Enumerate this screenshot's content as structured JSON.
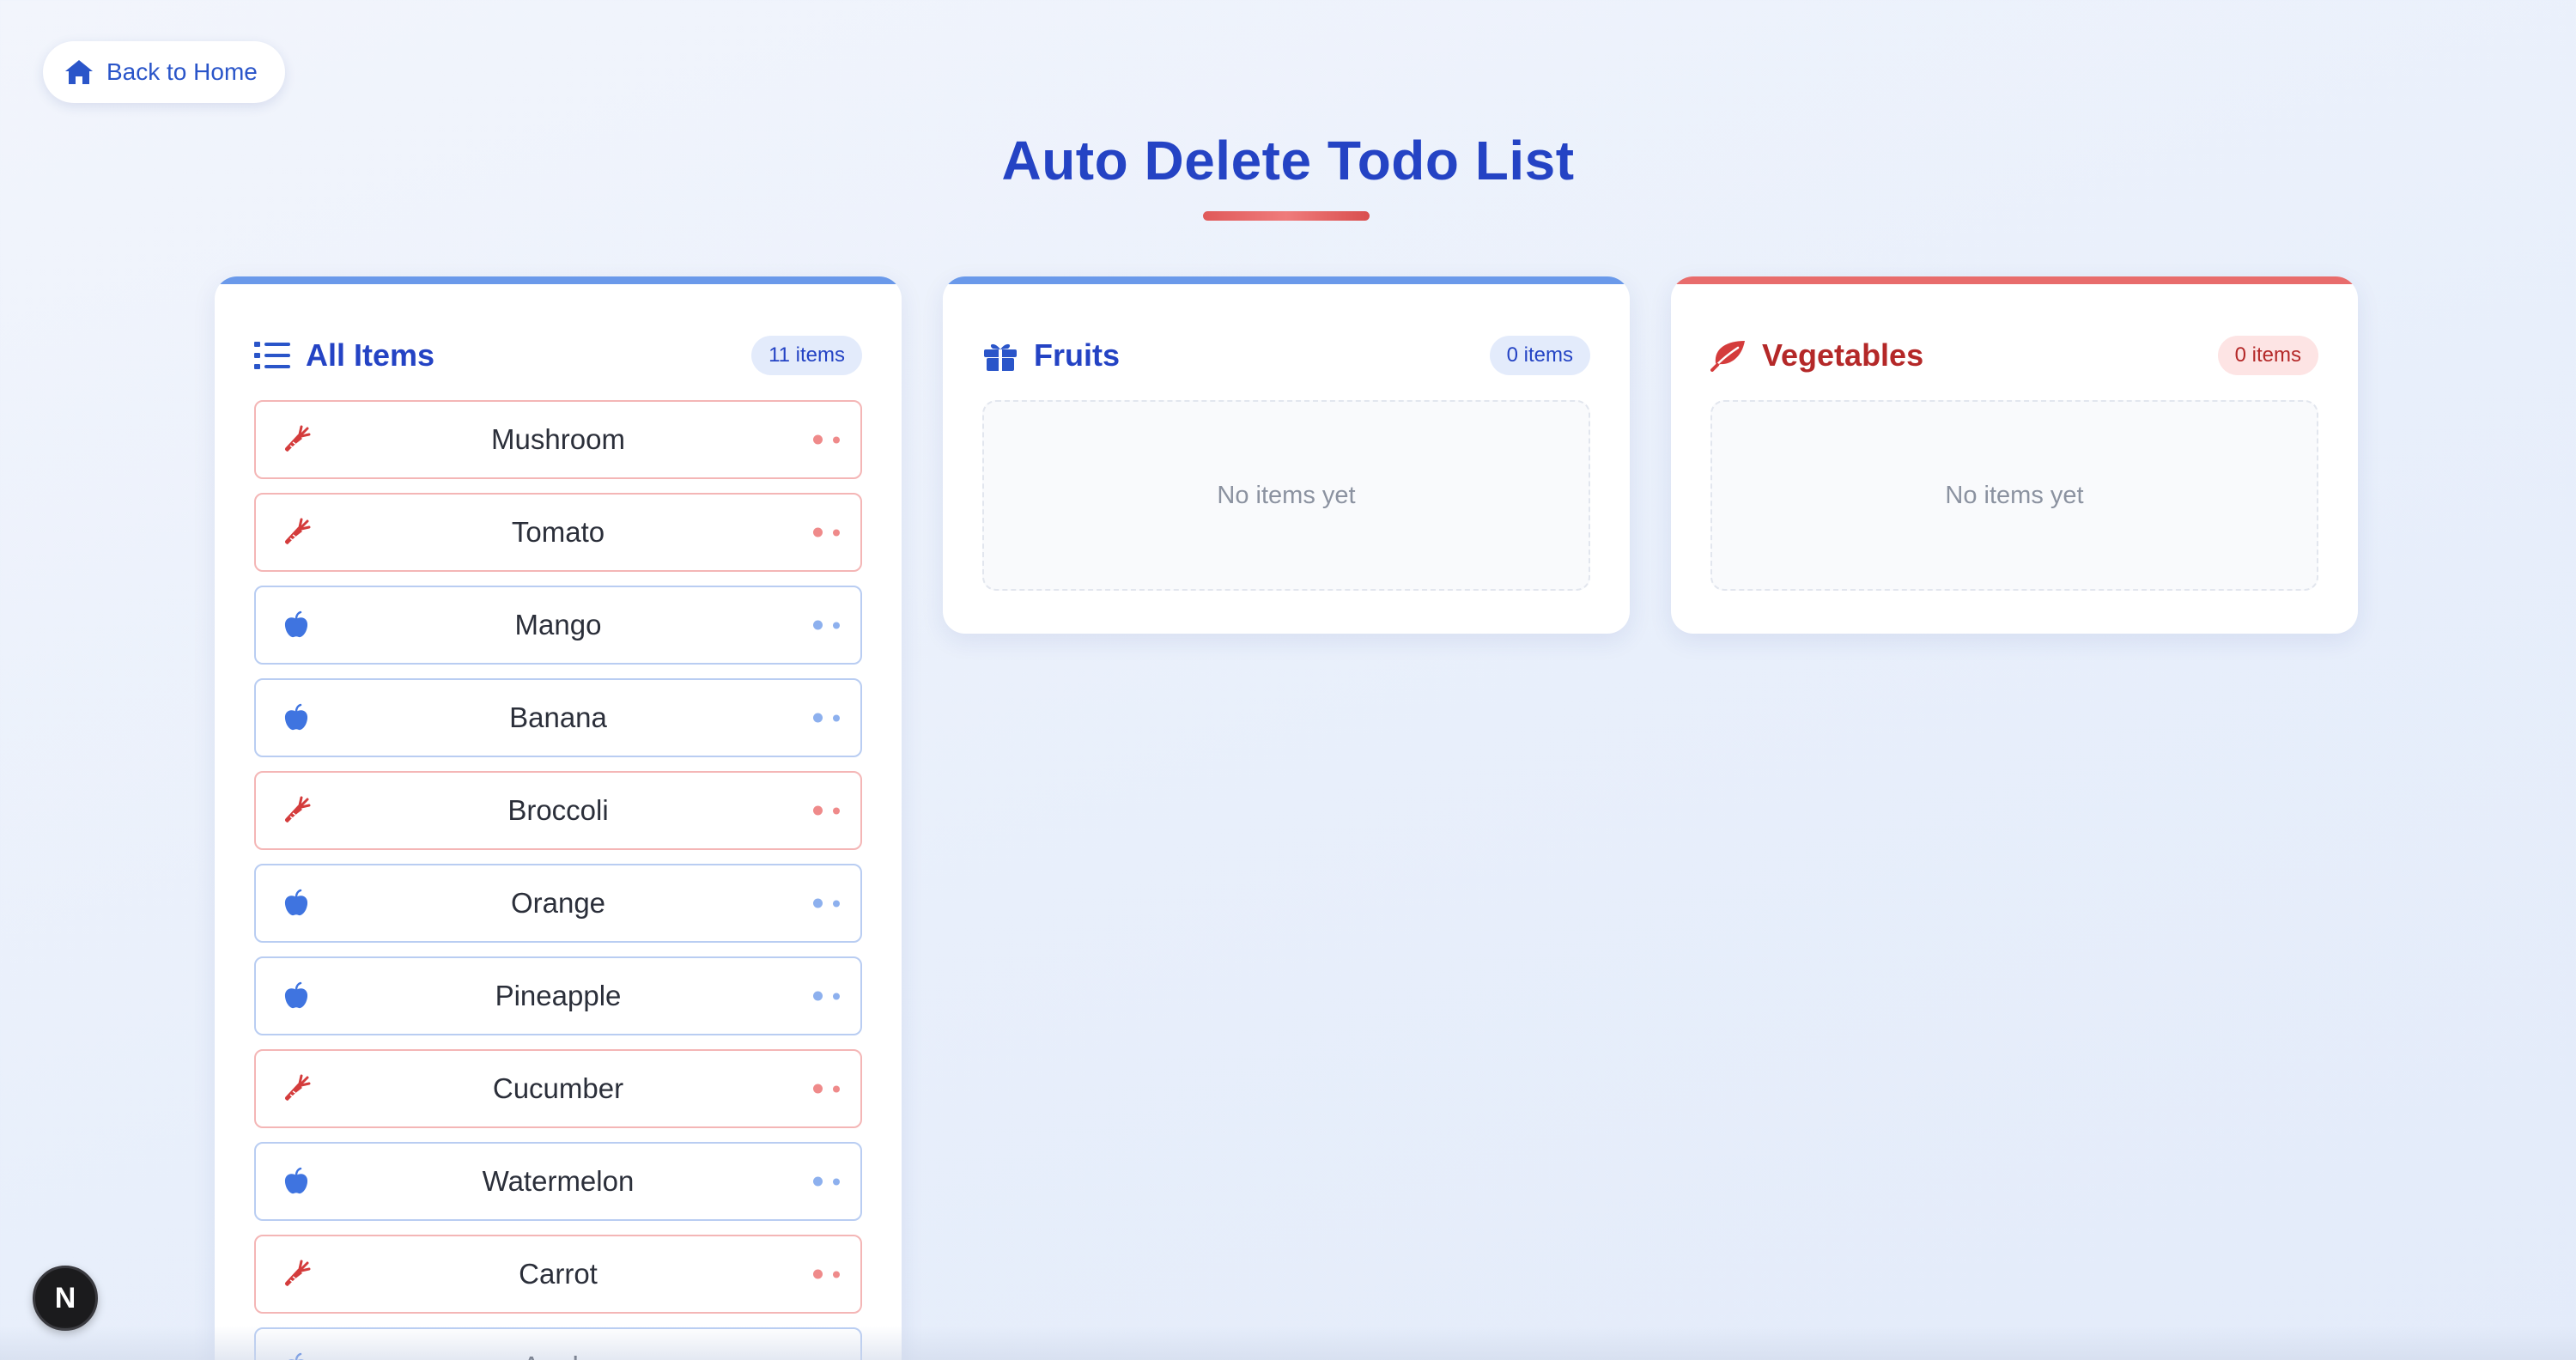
{
  "nav": {
    "back_label": "Back to Home"
  },
  "page": {
    "title": "Auto Delete Todo List"
  },
  "colors": {
    "primary": "#2443c4",
    "fruit_accent": "#6a99ea",
    "vegetable_accent": "#e86c6c",
    "vegetable_text": "#b42828"
  },
  "columns": {
    "all": {
      "title": "All Items",
      "count": "11 items",
      "icon": "list-icon",
      "items": [
        {
          "label": "Mushroom",
          "type": "Vegetable",
          "icon": "carrot-icon"
        },
        {
          "label": "Tomato",
          "type": "Vegetable",
          "icon": "carrot-icon"
        },
        {
          "label": "Mango",
          "type": "Fruit",
          "icon": "apple-icon"
        },
        {
          "label": "Banana",
          "type": "Fruit",
          "icon": "apple-icon"
        },
        {
          "label": "Broccoli",
          "type": "Vegetable",
          "icon": "carrot-icon"
        },
        {
          "label": "Orange",
          "type": "Fruit",
          "icon": "apple-icon"
        },
        {
          "label": "Pineapple",
          "type": "Fruit",
          "icon": "apple-icon"
        },
        {
          "label": "Cucumber",
          "type": "Vegetable",
          "icon": "carrot-icon"
        },
        {
          "label": "Watermelon",
          "type": "Fruit",
          "icon": "apple-icon"
        },
        {
          "label": "Carrot",
          "type": "Vegetable",
          "icon": "carrot-icon"
        },
        {
          "label": "Apple",
          "type": "Fruit",
          "icon": "apple-icon"
        }
      ]
    },
    "fruits": {
      "title": "Fruits",
      "count": "0 items",
      "icon": "gift-icon",
      "empty_text": "No items yet"
    },
    "vegetables": {
      "title": "Vegetables",
      "count": "0 items",
      "icon": "leaf-icon",
      "empty_text": "No items yet"
    }
  },
  "dev_badge": {
    "label": "N"
  }
}
